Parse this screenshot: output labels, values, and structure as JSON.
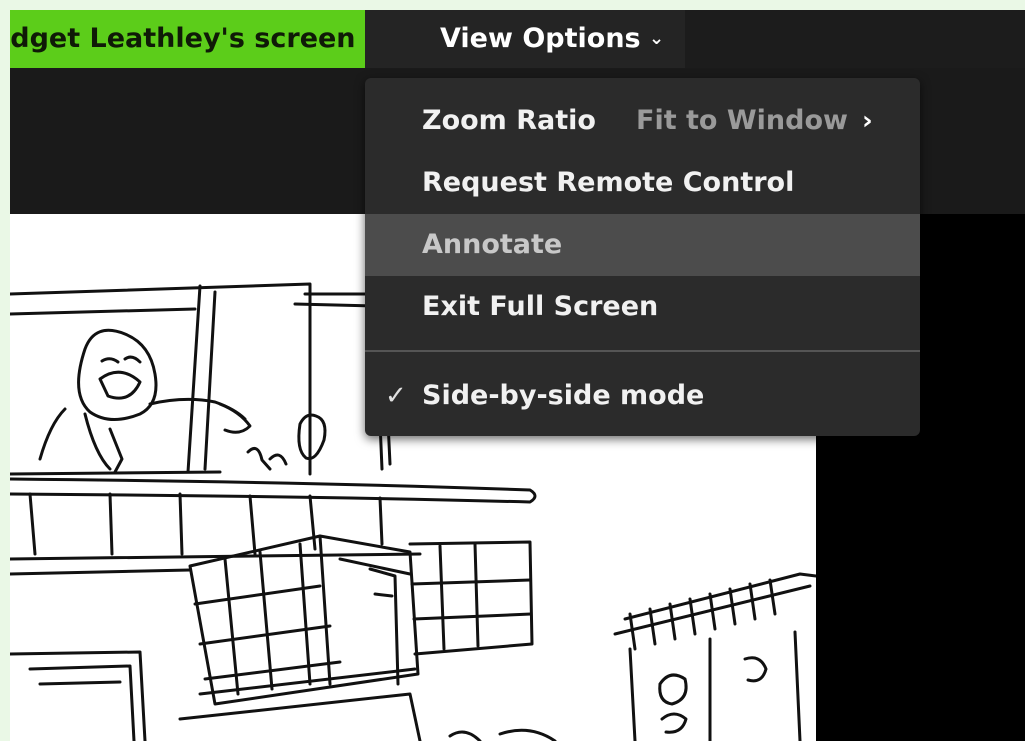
{
  "topbar": {
    "share_label": "ldget Leathley's screen",
    "view_options_label": "View Options",
    "view_options_chevron": "⌄"
  },
  "menu": {
    "zoom_ratio_label": "Zoom Ratio",
    "zoom_ratio_value": "Fit to Window",
    "zoom_ratio_arrow": "›",
    "request_remote_control_label": "Request Remote Control",
    "annotate_label": "Annotate",
    "exit_full_screen_label": "Exit Full Screen",
    "side_by_side_label": "Side-by-side mode",
    "side_by_side_checked": true,
    "check_mark": "✓"
  },
  "colors": {
    "share_badge": "#5ccd1a",
    "menu_bg": "#2b2b2b",
    "highlight_bg": "#4c4c4c",
    "page_bg": "#eaf8e6"
  }
}
